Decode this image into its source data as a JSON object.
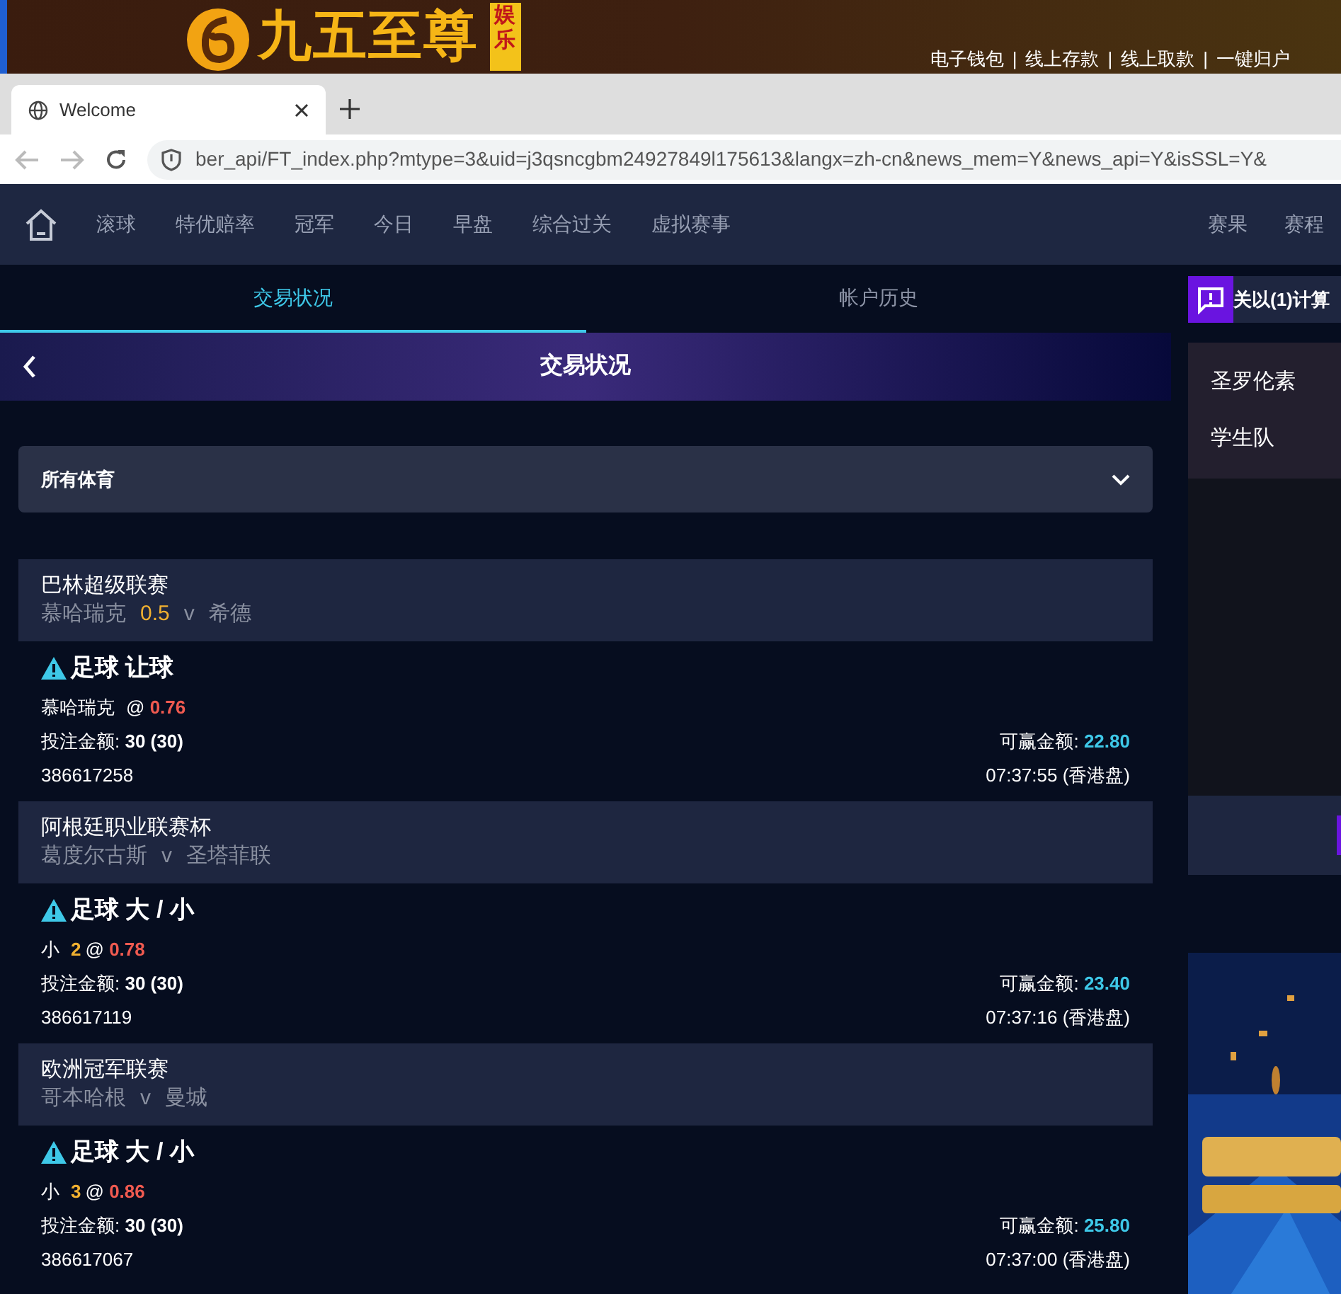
{
  "site_header": {
    "logo_text": "九五至尊",
    "logo_badge": "娱乐",
    "links": [
      "电子钱包",
      "线上存款",
      "线上取款",
      "一键归户"
    ],
    "separator": "|"
  },
  "browser": {
    "tab_title": "Welcome",
    "url": "ber_api/FT_index.php?mtype=3&uid=j3qsncgbm24927849l175613&langx=zh-cn&news_mem=Y&news_api=Y&isSSL=Y&"
  },
  "nav": {
    "items": [
      "滚球",
      "特优赔率",
      "冠军",
      "今日",
      "早盘",
      "综合过关",
      "虚拟赛事"
    ],
    "right_items": [
      "赛果",
      "赛程"
    ]
  },
  "tabs": [
    {
      "label": "交易状况",
      "selected": true
    },
    {
      "label": "帐户历史",
      "selected": false
    }
  ],
  "page_title": "交易状况",
  "sport_filter": {
    "value": "所有体育"
  },
  "bets": [
    {
      "league": "巴林超级联赛",
      "home": "慕哈瑞克",
      "line": "0.5",
      "vs": "v",
      "away": "希德",
      "market": "足球 让球",
      "pick": "慕哈瑞克",
      "at": "@",
      "odds": "0.76",
      "stake_label": "投注金额:",
      "stake": "30 (30)",
      "win_label": "可赢金额:",
      "win": "22.80",
      "ticket": "386617258",
      "time": "07:37:55 (香港盘)"
    },
    {
      "league": "阿根廷职业联赛杯",
      "home": "葛度尔古斯",
      "vs": "v",
      "away": "圣塔菲联",
      "market": "足球 大 / 小",
      "pick": "小",
      "pick_line": "2",
      "at": "@",
      "odds": "0.78",
      "stake_label": "投注金额:",
      "stake": "30 (30)",
      "win_label": "可赢金额:",
      "win": "23.40",
      "ticket": "386617119",
      "time": "07:37:16 (香港盘)"
    },
    {
      "league": "欧洲冠军联赛",
      "home": "哥本哈根",
      "vs": "v",
      "away": "曼城",
      "market": "足球 大 / 小",
      "pick": "小",
      "pick_line": "3",
      "at": "@",
      "odds": "0.86",
      "stake_label": "投注金额:",
      "stake": "30 (30)",
      "win_label": "可赢金额:",
      "win": "25.80",
      "ticket": "386617067",
      "time": "07:37:00 (香港盘)"
    }
  ],
  "side": {
    "notice": "关以(1)计算",
    "teams": [
      "圣罗伦素",
      "学生队"
    ],
    "banner": {
      "kind": "picture"
    }
  }
}
